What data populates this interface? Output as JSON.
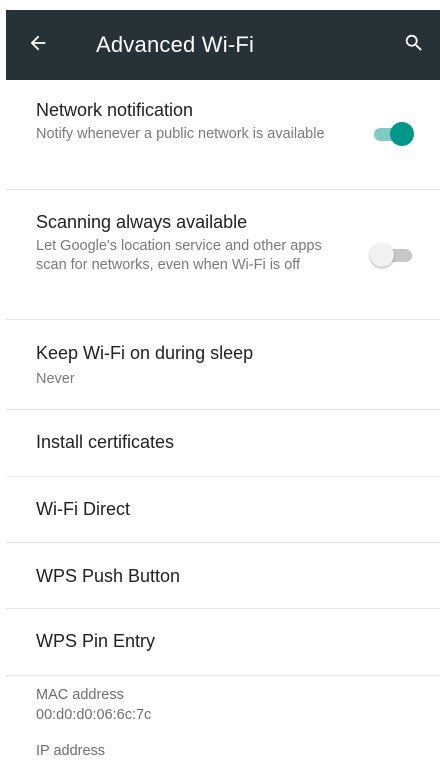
{
  "appbar": {
    "title": "Advanced Wi-Fi",
    "back_icon": "arrow-left-icon",
    "search_icon": "search-icon",
    "background": "#263238"
  },
  "settings": [
    {
      "title": "Network notification",
      "summary": "Notify whenever a public network is available",
      "toggle": true
    },
    {
      "title": "Scanning always available",
      "summary": "Let Google's location service and other apps scan for networks, even when Wi-Fi is off",
      "toggle": false
    },
    {
      "title": "Keep Wi-Fi on during sleep",
      "summary": "Never"
    },
    {
      "title": "Install certificates"
    },
    {
      "title": "Wi-Fi Direct"
    },
    {
      "title": "WPS Push Button"
    },
    {
      "title": "WPS Pin Entry"
    }
  ],
  "info": {
    "mac_label": "MAC address",
    "mac_value": "00:d0:d0:06:6c:7c",
    "ip_label": "IP address"
  },
  "colors": {
    "accent": "#009688"
  }
}
